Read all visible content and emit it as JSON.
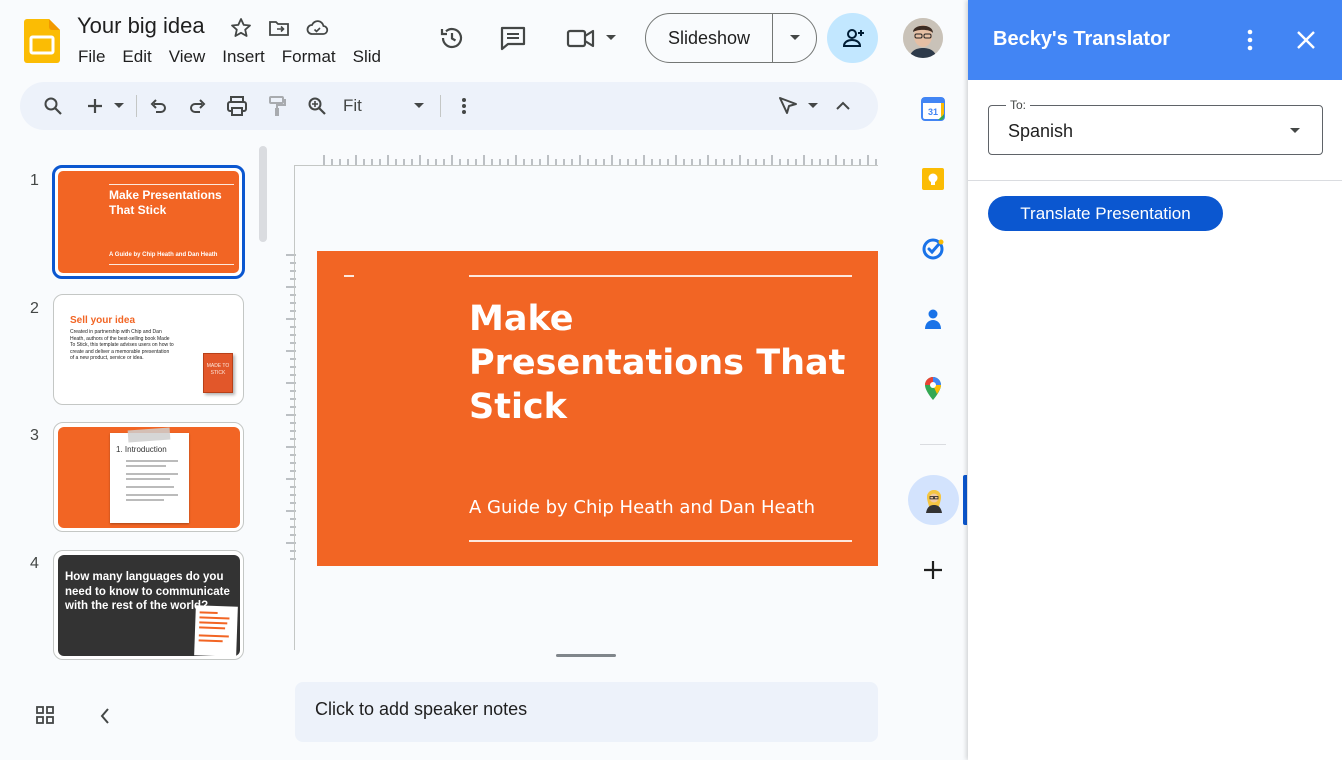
{
  "app": {
    "title": "Your big idea",
    "menu": [
      "File",
      "Edit",
      "View",
      "Insert",
      "Format",
      "Slid"
    ],
    "slideshow_label": "Slideshow",
    "zoom_label": "Fit",
    "notes_placeholder": "Click to add speaker notes",
    "accent_color": "#0b57d0",
    "logo_color": "#fbbc04"
  },
  "slides": [
    {
      "number": "1",
      "title": "Make Presentations That Stick",
      "subtitle": "A Guide by Chip Heath and Dan Heath"
    },
    {
      "number": "2",
      "title": "Sell your idea",
      "body": "Created in partnership with Chip and Dan Heath, authors of the best-selling book Made To Stick, this template advises users on how to create and deliver a memorable presentation of a new product, service or idea.",
      "book_label": "MADE TO STICK"
    },
    {
      "number": "3",
      "heading": "1. Introduction"
    },
    {
      "number": "4",
      "title": "How many languages do you need to know to communicate with the rest of the world?"
    }
  ],
  "main_slide": {
    "title": "Make Presentations That Stick",
    "subtitle": "A Guide by Chip Heath and Dan Heath",
    "color": "#f26524"
  },
  "side_apps": [
    "calendar-icon",
    "keep-icon",
    "tasks-icon",
    "contacts-icon",
    "maps-icon",
    "translator-addon-icon",
    "add-icon"
  ],
  "panel": {
    "title": "Becky's Translator",
    "to_label": "To:",
    "language": "Spanish",
    "translate_button": "Translate Presentation",
    "header_color": "#4285f4"
  }
}
